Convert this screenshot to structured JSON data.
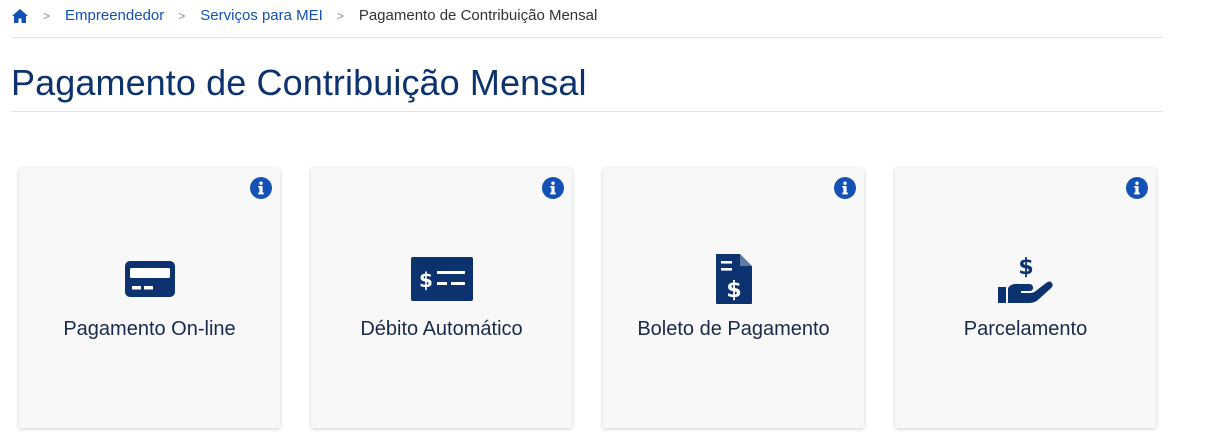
{
  "breadcrumb": {
    "items": [
      {
        "label": "Empreendedor"
      },
      {
        "label": "Serviços para MEI"
      }
    ],
    "current": "Pagamento de Contribuição Mensal",
    "separator": ">"
  },
  "page": {
    "title": "Pagamento de Contribuição Mensal"
  },
  "cards": [
    {
      "label": "Pagamento On-line",
      "icon": "credit-card-icon",
      "info_icon": "info-icon"
    },
    {
      "label": "Débito Automático",
      "icon": "check-money-icon",
      "info_icon": "info-icon"
    },
    {
      "label": "Boleto de Pagamento",
      "icon": "invoice-dollar-icon",
      "info_icon": "info-icon"
    },
    {
      "label": "Parcelamento",
      "icon": "hand-holding-dollar-icon",
      "info_icon": "info-icon"
    }
  ],
  "colors": {
    "primary_blue": "#1351b4",
    "title_blue": "#0c326f",
    "icon_navy": "#0c326f",
    "card_bg": "#f8f8f8"
  }
}
